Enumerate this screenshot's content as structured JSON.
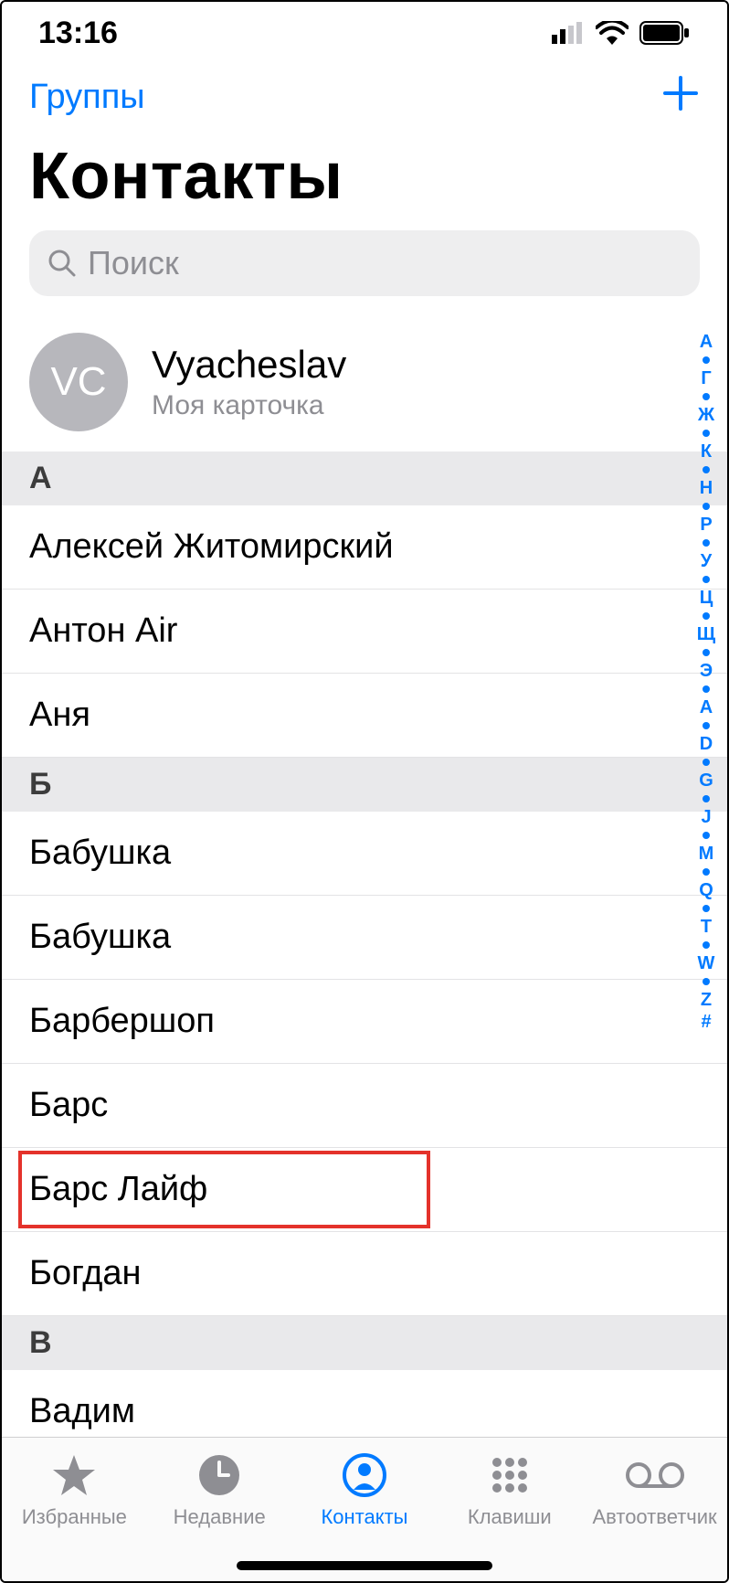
{
  "status": {
    "time": "13:16"
  },
  "nav": {
    "groups_label": "Группы"
  },
  "title": "Контакты",
  "search": {
    "placeholder": "Поиск"
  },
  "my_card": {
    "initials": "VC",
    "name": "Vyacheslav",
    "subtitle": "Моя карточка"
  },
  "sections": [
    {
      "letter": "А",
      "contacts": [
        "Алексей Житомирский",
        "Антон Air",
        "Аня"
      ]
    },
    {
      "letter": "Б",
      "contacts": [
        "Бабушка",
        "Бабушка",
        "Барбершоп",
        "Барс",
        "Барс Лайф",
        "Богдан"
      ]
    },
    {
      "letter": "В",
      "contacts": [
        "Вадим"
      ]
    }
  ],
  "highlighted_contact": "Барс Лайф",
  "alpha_index": [
    "А",
    "•",
    "Г",
    "•",
    "Ж",
    "•",
    "К",
    "•",
    "Н",
    "•",
    "Р",
    "•",
    "У",
    "•",
    "Ц",
    "•",
    "Щ",
    "•",
    "Э",
    "•",
    "A",
    "•",
    "D",
    "•",
    "G",
    "•",
    "J",
    "•",
    "M",
    "•",
    "Q",
    "•",
    "T",
    "•",
    "W",
    "•",
    "Z",
    "#"
  ],
  "tabs": {
    "favorites": "Избранные",
    "recents": "Недавние",
    "contacts": "Контакты",
    "keypad": "Клавиши",
    "voicemail": "Автоответчик"
  },
  "active_tab": "contacts"
}
